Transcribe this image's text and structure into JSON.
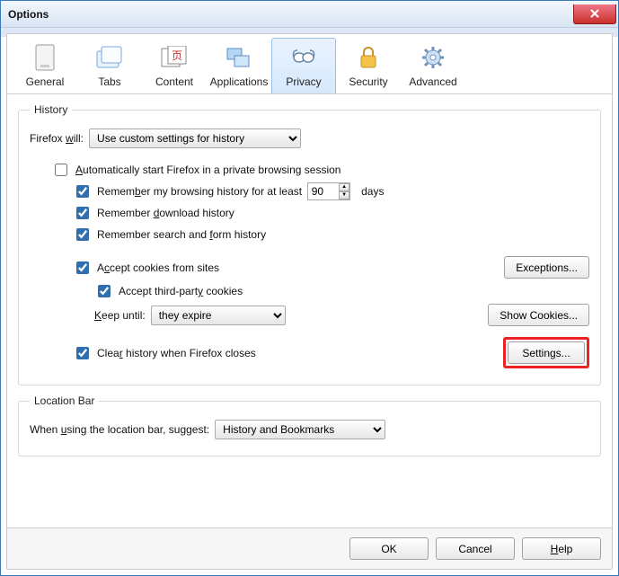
{
  "window": {
    "title": "Options"
  },
  "tabs": {
    "items": [
      {
        "label": "General"
      },
      {
        "label": "Tabs"
      },
      {
        "label": "Content"
      },
      {
        "label": "Applications"
      },
      {
        "label": "Privacy"
      },
      {
        "label": "Security"
      },
      {
        "label": "Advanced"
      }
    ],
    "selected_index": 4
  },
  "history": {
    "legend": "History",
    "will_label_prefix": "Firefox ",
    "will_label_u": "w",
    "will_label_suffix": "ill:",
    "will_value": "Use custom settings for history",
    "auto_private": {
      "checked": false,
      "prefix": "",
      "u": "A",
      "suffix": "utomatically start Firefox in a private browsing session"
    },
    "remember_browsing": {
      "checked": true,
      "prefix": "Remem",
      "u": "b",
      "suffix": "er my browsing history for at least",
      "days_value": 90,
      "days_label": "days"
    },
    "remember_download": {
      "checked": true,
      "prefix": "Remember ",
      "u": "d",
      "suffix": "ownload history"
    },
    "remember_form": {
      "checked": true,
      "prefix": "Remember search and ",
      "u": "f",
      "suffix": "orm history"
    },
    "accept_cookies": {
      "checked": true,
      "prefix": "A",
      "u": "c",
      "suffix": "cept cookies from sites"
    },
    "accept_third": {
      "checked": true,
      "prefix": "Accept third-part",
      "u": "y",
      "suffix": " cookies"
    },
    "keep_until": {
      "label_prefix": "",
      "label_u": "K",
      "label_suffix": "eep until:",
      "value": "they expire"
    },
    "clear_on_close": {
      "checked": true,
      "prefix": "Clea",
      "u": "r",
      "suffix": " history when Firefox closes"
    },
    "btn_exceptions": "Exceptions...",
    "btn_show_cookies": "Show Cookies...",
    "btn_settings": "Settings..."
  },
  "location_bar": {
    "legend": "Location Bar",
    "label_prefix": "When ",
    "label_u": "u",
    "label_suffix": "sing the location bar, suggest:",
    "value": "History and Bookmarks"
  },
  "footer": {
    "ok": "OK",
    "cancel": "Cancel",
    "help_u": "H",
    "help_suffix": "elp"
  }
}
